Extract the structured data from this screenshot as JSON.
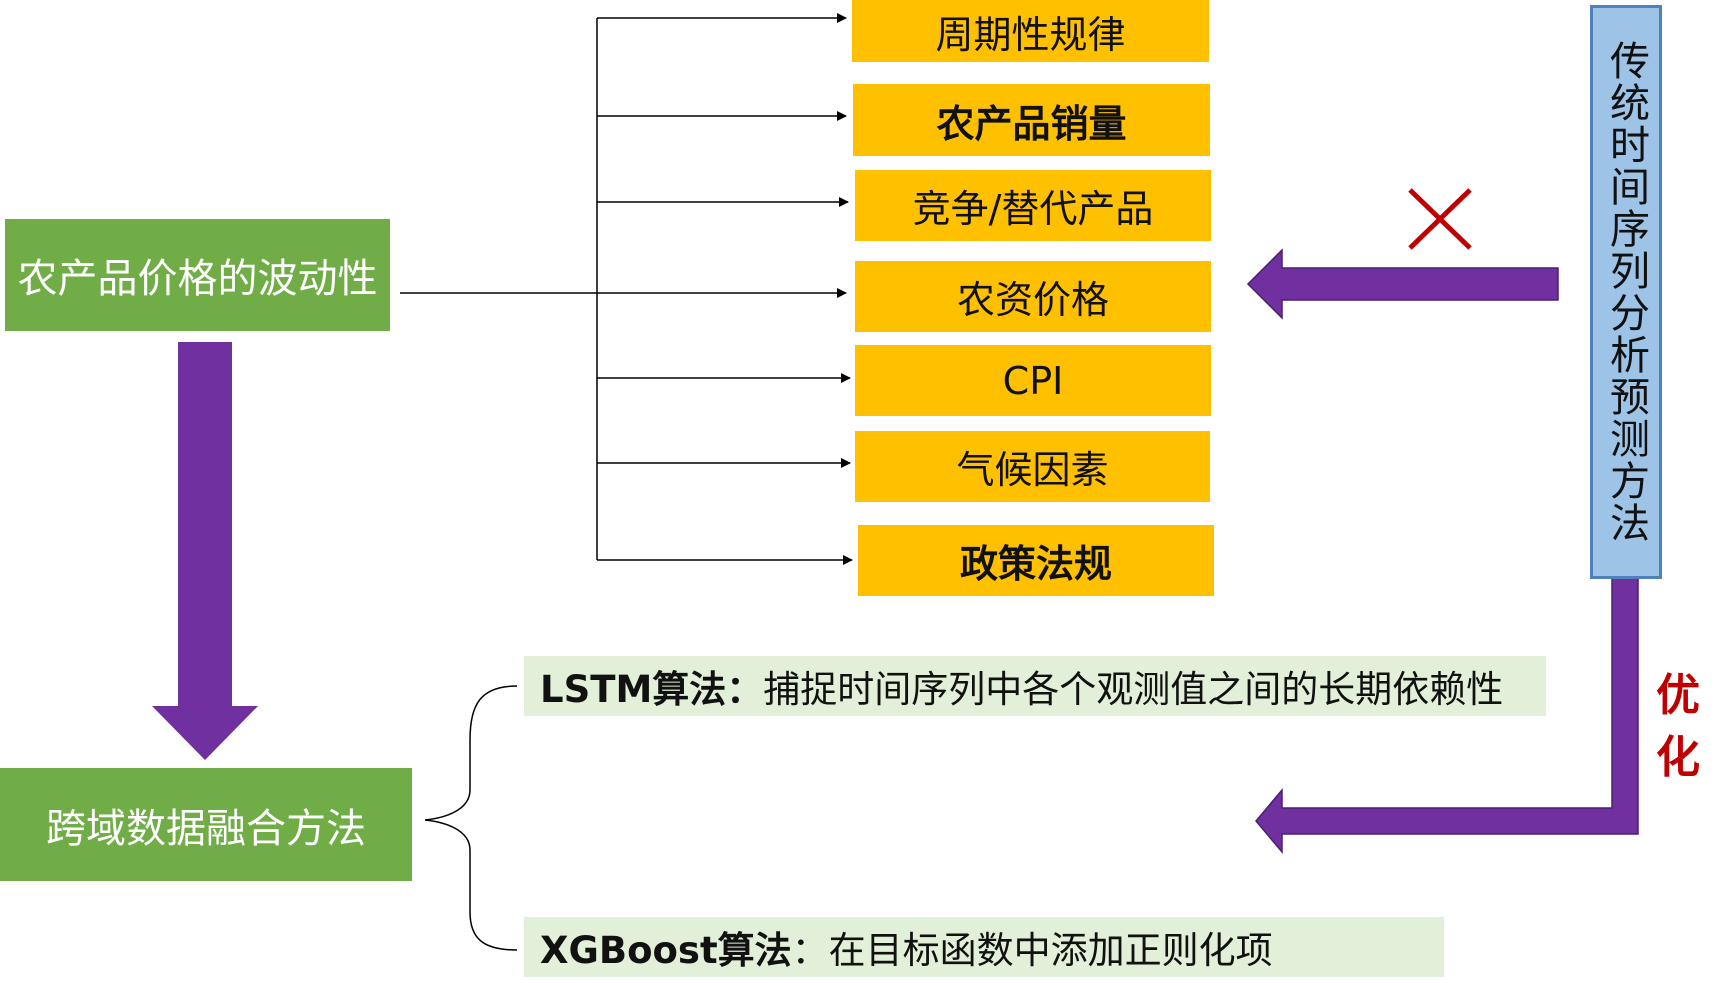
{
  "root": {
    "label": "农产品价格的波动性"
  },
  "fusion": {
    "label": "跨域数据融合方法"
  },
  "factors": [
    {
      "label": "周期性规律",
      "bold": false
    },
    {
      "label": "农产品销量",
      "bold": true
    },
    {
      "label": "竞争/替代产品",
      "bold": false
    },
    {
      "label": "农资价格",
      "bold": false
    },
    {
      "label": "CPI",
      "bold": false
    },
    {
      "label": "气候因素",
      "bold": false
    },
    {
      "label": "政策法规",
      "bold": true
    }
  ],
  "traditional": {
    "label": "传统时间序列分析预测方法"
  },
  "optimize": {
    "label": "优化"
  },
  "cross": {
    "label": "✕"
  },
  "algorithms": [
    {
      "name": "LSTM算法：",
      "desc": "捕捉时间序列中各个观测值之间的长期依赖性"
    },
    {
      "name": "XGBoost算法",
      "desc": "：在目标函数中添加正则化项"
    }
  ],
  "colors": {
    "green": "#70ad47",
    "orange": "#ffc000",
    "purple": "#7030a0",
    "blue": "#9dc3e6",
    "red": "#c00000",
    "lightgreen": "#e2f0d9"
  }
}
